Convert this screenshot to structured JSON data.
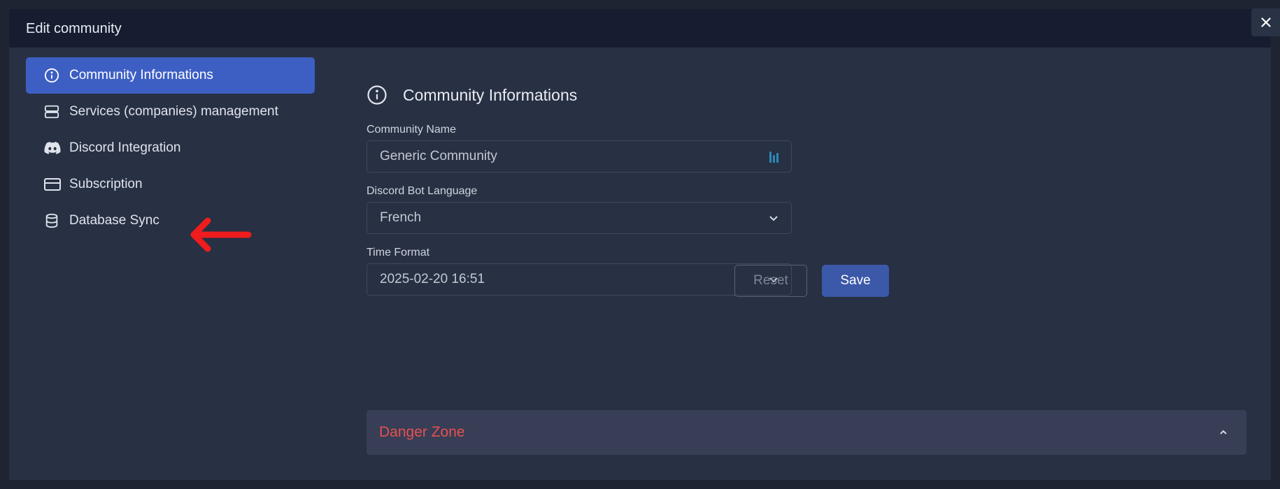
{
  "modal": {
    "title": "Edit community",
    "close_icon": "close-icon"
  },
  "sidebar": {
    "items": [
      {
        "label": "Community Informations",
        "icon": "info-icon",
        "active": true
      },
      {
        "label": "Services (companies) management",
        "icon": "server-icon",
        "active": false
      },
      {
        "label": "Discord Integration",
        "icon": "discord-icon",
        "active": false
      },
      {
        "label": "Subscription",
        "icon": "credit-card-icon",
        "active": false
      },
      {
        "label": "Database Sync",
        "icon": "database-icon",
        "active": false
      }
    ]
  },
  "annotation": {
    "icon": "red-arrow-icon",
    "color": "#ee1c1c"
  },
  "main": {
    "section_title": "Community Informations",
    "fields": {
      "community_name": {
        "label": "Community Name",
        "value": "Generic Community"
      },
      "bot_language": {
        "label": "Discord Bot Language",
        "value": "French"
      },
      "time_format": {
        "label": "Time Format",
        "value": "2025-02-20 16:51"
      }
    },
    "buttons": {
      "reset": "Reset",
      "save": "Save"
    },
    "danger_zone": {
      "title": "Danger Zone"
    }
  },
  "colors": {
    "accent": "#3d5fc4",
    "save": "#3c58a8",
    "danger": "#e8504f",
    "background": "#283043",
    "header": "#161d30"
  }
}
